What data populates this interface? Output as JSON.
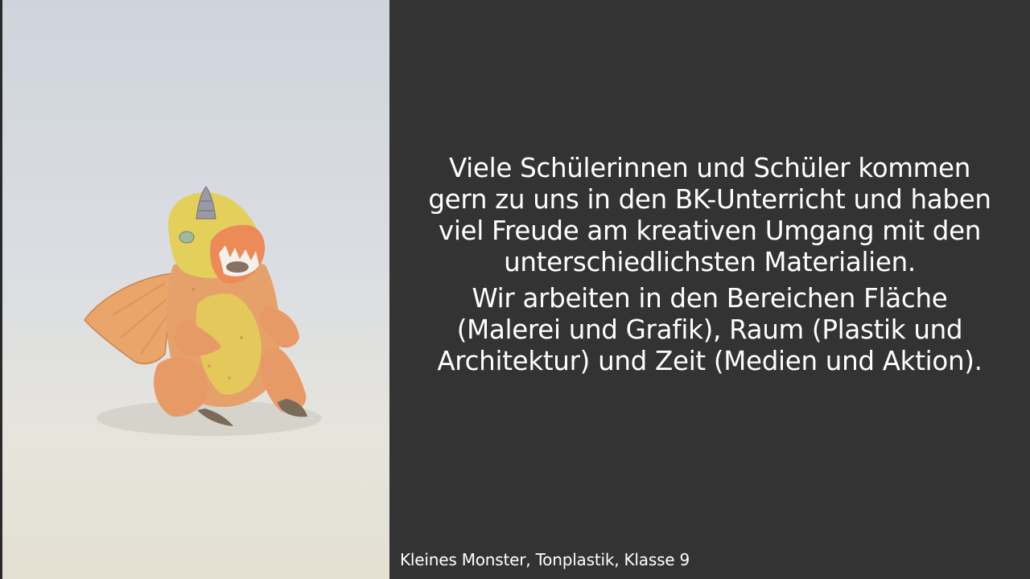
{
  "slide": {
    "paragraphs": [
      "Viele Schülerinnen und Schüler kommen gern zu uns in den BK-Unterricht und haben viel Freude am kreativen Umgang mit den unterschiedlichsten Materialien.",
      "Wir arbeiten in den Bereichen Fläche (Malerei und Grafik), Raum (Plastik und Architektur) und Zeit (Medien und Aktion)."
    ],
    "caption": "Kleines Monster, Tonplastik, Klasse 9",
    "colors": {
      "background": "#333333",
      "text": "#ffffff",
      "sculpture_body": "#e9a86a",
      "sculpture_accent": "#e7d45a"
    }
  }
}
